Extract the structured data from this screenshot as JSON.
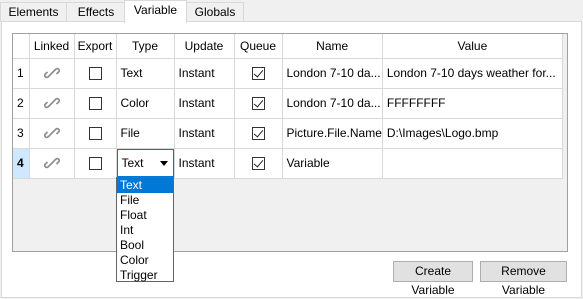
{
  "tabs": [
    {
      "label": "Elements"
    },
    {
      "label": "Effects"
    },
    {
      "label": "Variable"
    },
    {
      "label": "Globals"
    }
  ],
  "active_tab": "Variable",
  "grid": {
    "columns": [
      "Linked",
      "Export",
      "Type",
      "Update",
      "Queue",
      "Name",
      "Value"
    ],
    "rows": [
      {
        "num": "1",
        "linked": "link-icon",
        "export": false,
        "type": "Text",
        "update": "Instant",
        "queue": true,
        "name": "London 7-10 da...",
        "value": "London 7-10 days weather for..."
      },
      {
        "num": "2",
        "linked": "link-icon",
        "export": false,
        "type": "Color",
        "update": "Instant",
        "queue": true,
        "name": "London 7-10 da...",
        "value": "FFFFFFFF"
      },
      {
        "num": "3",
        "linked": "link-icon",
        "export": false,
        "type": "File",
        "update": "Instant",
        "queue": true,
        "name": "Picture.File.Name",
        "value": "D:\\Images\\Logo.bmp"
      },
      {
        "num": "4",
        "linked": "link-icon",
        "export": false,
        "type": "Text",
        "update": "Instant",
        "queue": true,
        "name": "Variable",
        "value": ""
      }
    ]
  },
  "type_dropdown": {
    "selected": "Text",
    "options": [
      "Text",
      "File",
      "Float",
      "Int",
      "Bool",
      "Color",
      "Trigger"
    ]
  },
  "buttons": {
    "create": "Create Variable",
    "remove": "Remove Variable"
  }
}
